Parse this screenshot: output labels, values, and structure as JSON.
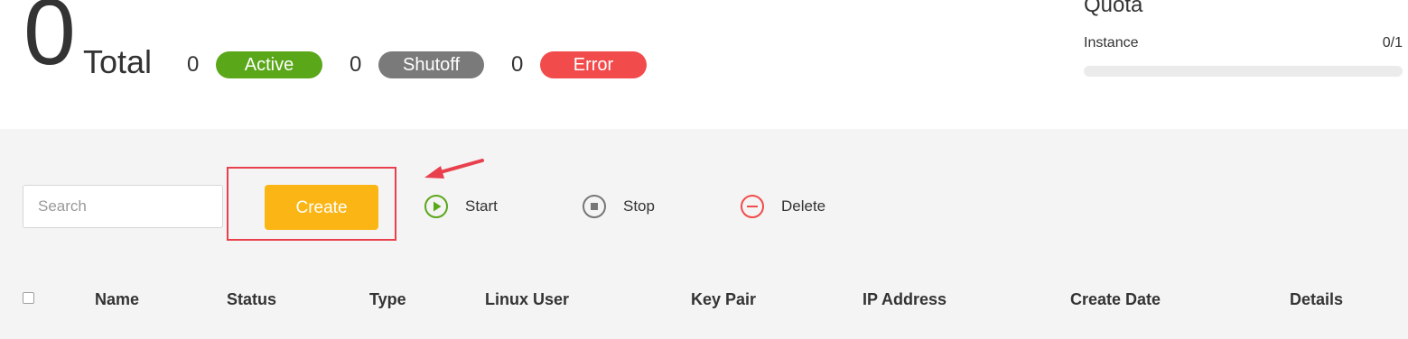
{
  "summary": {
    "total_count": "0",
    "total_label": "Total",
    "active_count": "0",
    "active_label": "Active",
    "shutoff_count": "0",
    "shutoff_label": "Shutoff",
    "error_count": "0",
    "error_label": "Error"
  },
  "quota": {
    "title": "Quota",
    "instance_label": "Instance",
    "instance_value": "0/1",
    "instance_used_fraction": 0
  },
  "toolbar": {
    "search_placeholder": "Search",
    "create_label": "Create",
    "start_label": "Start",
    "stop_label": "Stop",
    "delete_label": "Delete"
  },
  "table": {
    "columns": [
      "Name",
      "Status",
      "Type",
      "Linux User",
      "Key Pair",
      "IP Address",
      "Create Date",
      "Details"
    ]
  },
  "colors": {
    "active": "#5ba71a",
    "shutoff": "#7a7a7a",
    "error": "#f24b4b",
    "create": "#fbb514",
    "annotation": "#e8404c"
  },
  "icons": {
    "start": "play-circle-icon",
    "stop": "stop-circle-icon",
    "delete": "minus-circle-icon",
    "annotation": "arrow-icon"
  }
}
